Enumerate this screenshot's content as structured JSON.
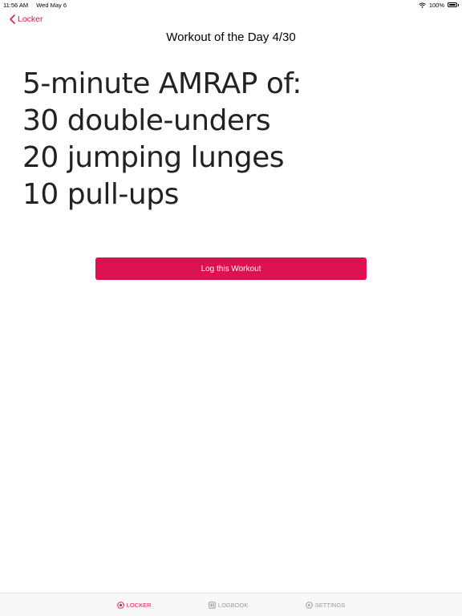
{
  "status": {
    "time": "11:56 AM",
    "date": "Wed May 6",
    "battery": "100%"
  },
  "nav": {
    "back_label": "Locker"
  },
  "page": {
    "title": "Workout of the Day 4/30"
  },
  "workout": {
    "lines": [
      "5-minute AMRAP of:",
      "30 double-unders",
      "20 jumping lunges",
      "10 pull-ups"
    ]
  },
  "actions": {
    "log_label": "Log this Workout"
  },
  "tabs": [
    {
      "label": "LOCKER",
      "icon": "locker-icon",
      "active": true
    },
    {
      "label": "LOGBOOK",
      "icon": "logbook-icon",
      "active": false
    },
    {
      "label": "SETTINGS",
      "icon": "settings-icon",
      "active": false
    }
  ],
  "colors": {
    "accent": "#de1150",
    "tab_inactive": "#9a9a9a"
  }
}
